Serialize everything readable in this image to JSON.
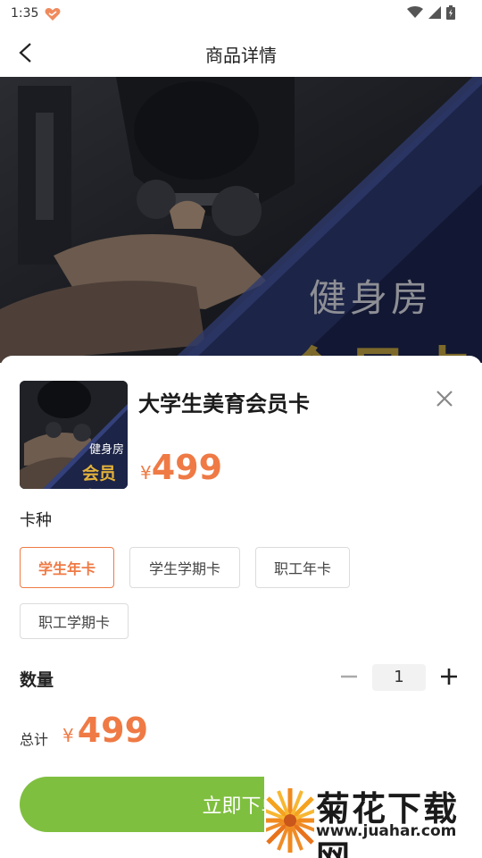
{
  "status_bar": {
    "time": "1:35"
  },
  "header": {
    "title": "商品详情"
  },
  "banner": {
    "line1": "健身房",
    "line2": "会员卡"
  },
  "product": {
    "thumb_line1": "健身房",
    "thumb_line2": "会员卡",
    "title": "大学生美育会员卡",
    "currency": "¥",
    "price": "499"
  },
  "card_type": {
    "label": "卡种",
    "options": [
      "学生年卡",
      "学生学期卡",
      "职工年卡",
      "职工学期卡"
    ],
    "selected": "学生年卡"
  },
  "quantity": {
    "label": "数量",
    "value": "1"
  },
  "total": {
    "label": "总计",
    "currency": "¥",
    "amount": "499"
  },
  "buy_button": {
    "label": "立即下单"
  },
  "watermark": {
    "title": "菊花下载网",
    "url": "www.juahar.com"
  },
  "colors": {
    "accent": "#ef7a45",
    "button": "#7fbf3f"
  }
}
